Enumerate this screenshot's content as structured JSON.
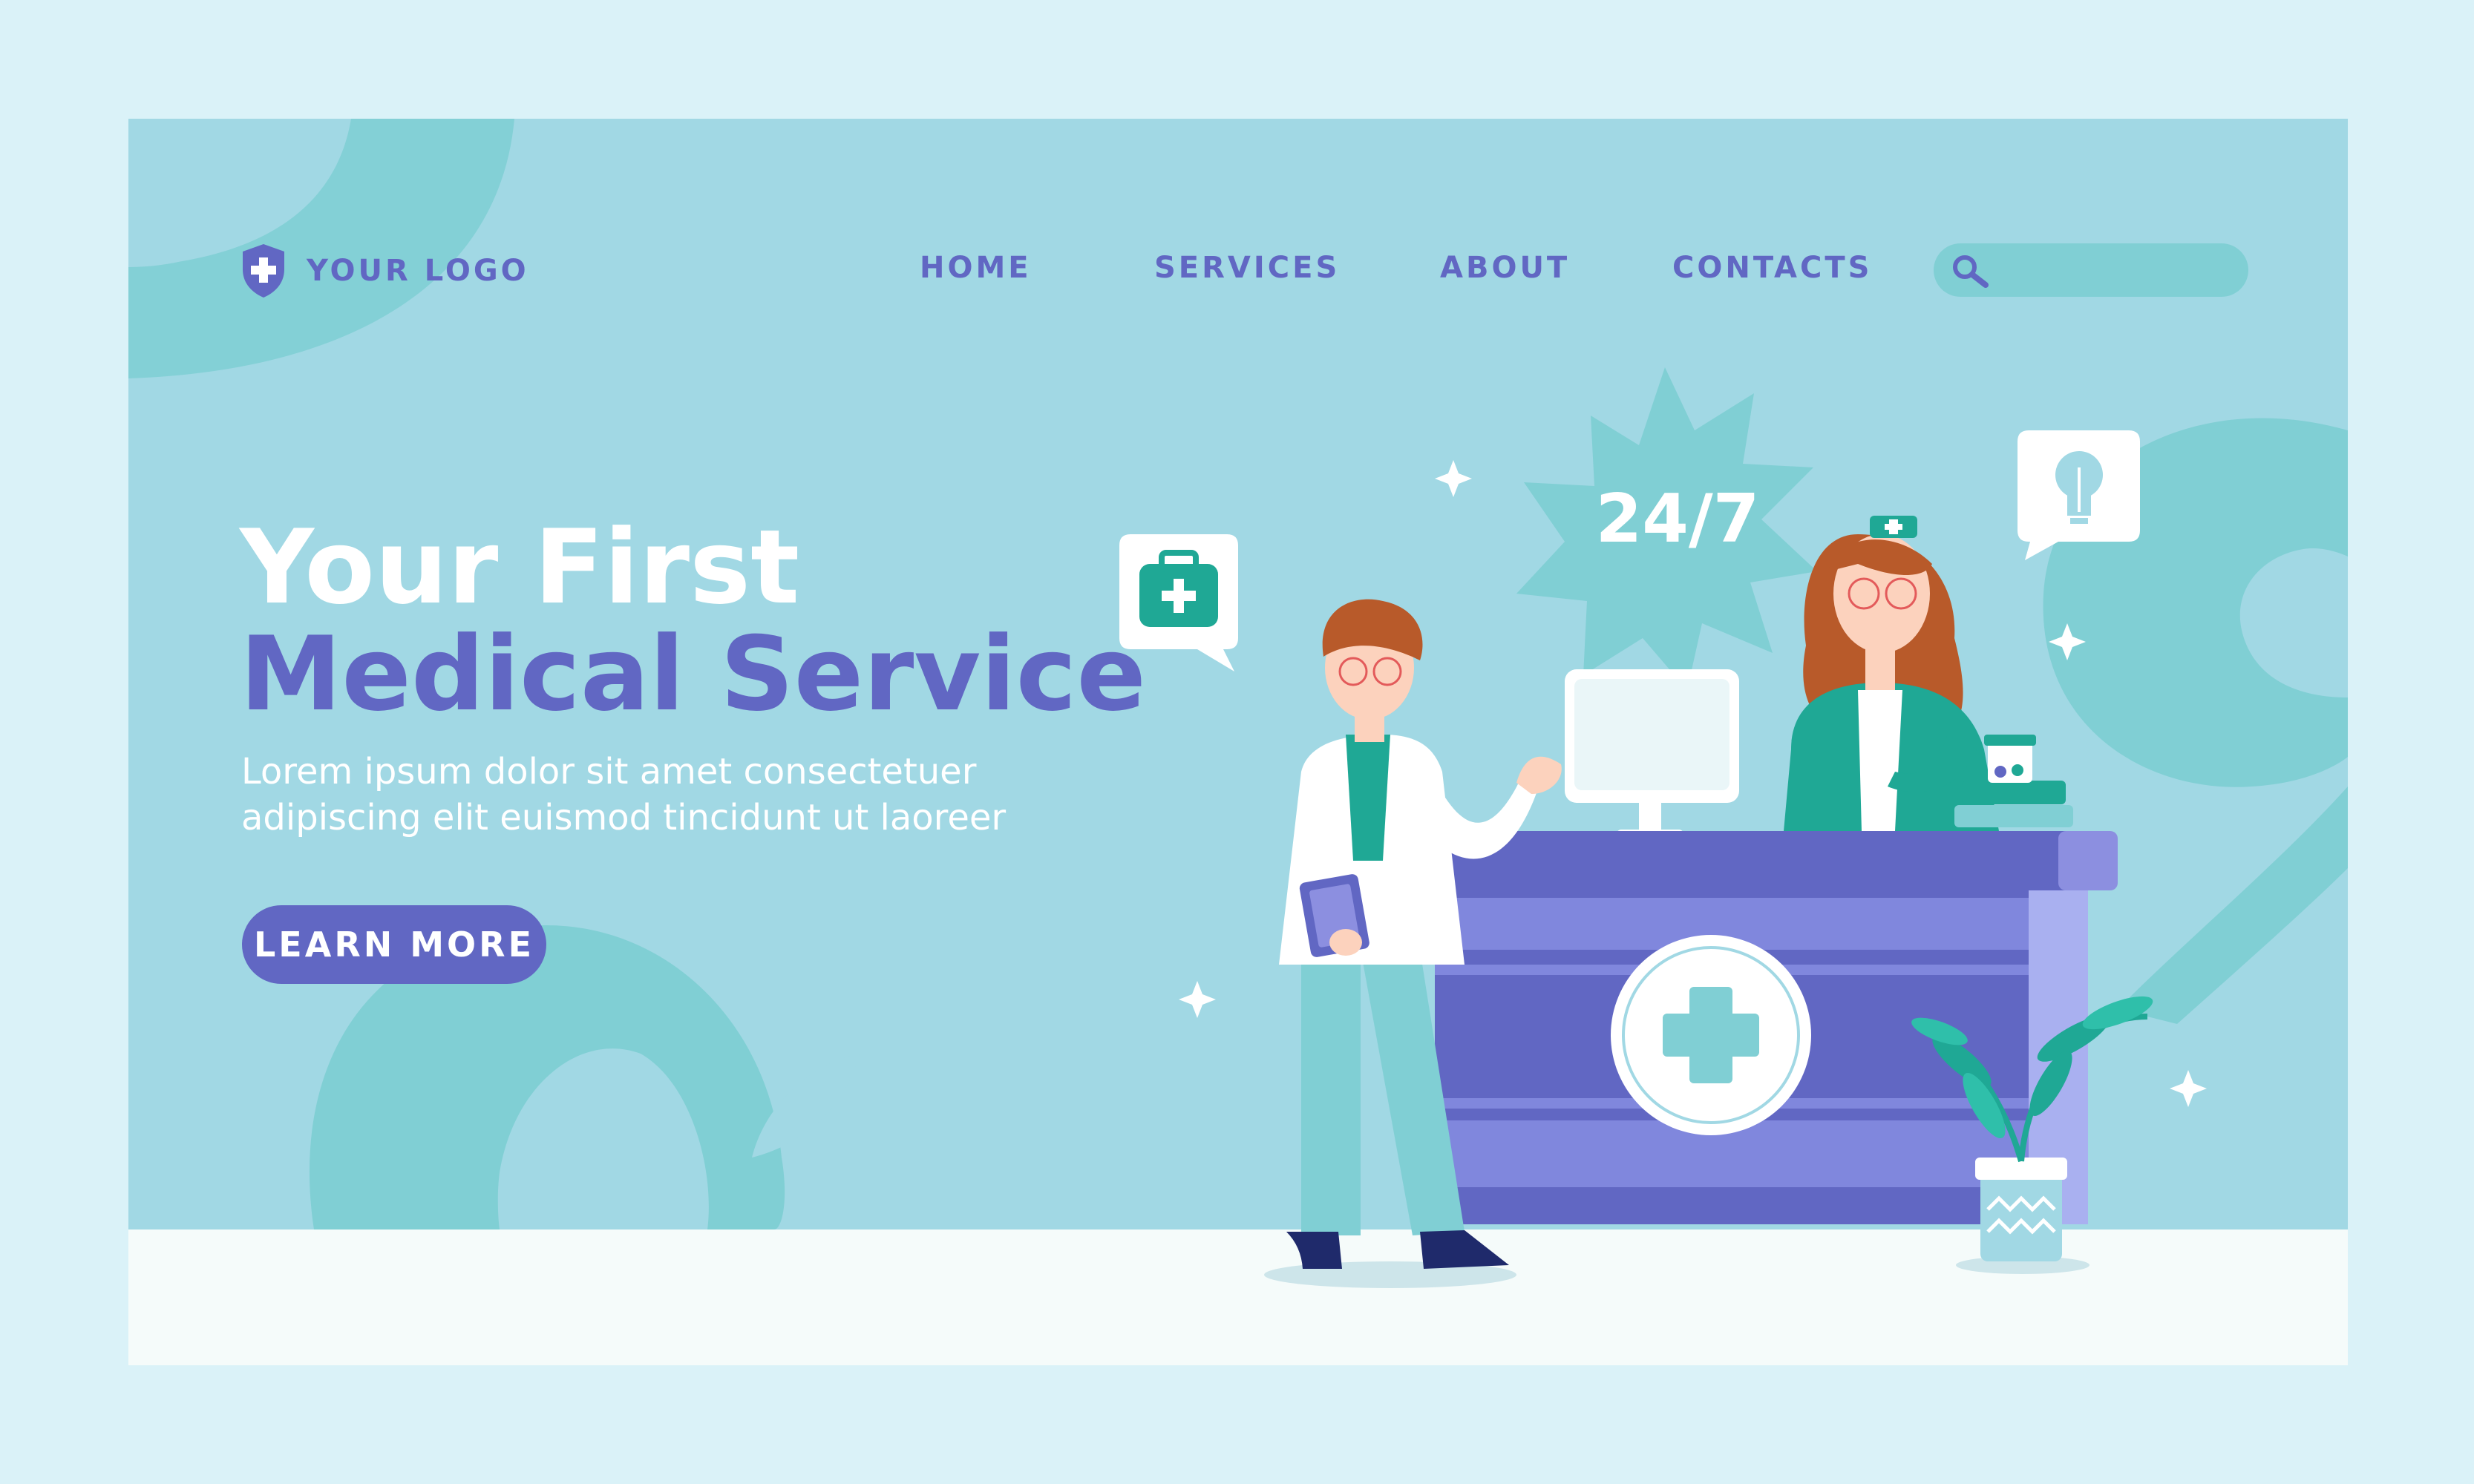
{
  "logo": {
    "text": "YOUR LOGO",
    "icon": "shield-cross-icon"
  },
  "nav": {
    "items": [
      {
        "label": "HOME"
      },
      {
        "label": "SERVICES"
      },
      {
        "label": "ABOUT"
      },
      {
        "label": "CONTACTS"
      }
    ]
  },
  "search": {
    "icon": "search-icon",
    "value": "",
    "placeholder": ""
  },
  "hero": {
    "title_line1": "Your First",
    "title_line2": "Medical Service",
    "subtitle_line1": "Lorem ipsum dolor sit amet consectetuer",
    "subtitle_line2": "adipiscing elit euismod tincidunt ut laoreer",
    "cta_label": "LEARN MORE"
  },
  "illustration": {
    "badge_text": "24/7",
    "icons": [
      "first-aid-kit-icon",
      "lightbulb-icon",
      "medical-cross-icon",
      "sparkle-icon"
    ]
  },
  "colors": {
    "background": "#daf2f8",
    "frame": "#a1d8e4",
    "accent_purple": "#6167c3",
    "teal": "#80cfd4",
    "dark_teal": "#1fa895",
    "white": "#ffffff"
  }
}
